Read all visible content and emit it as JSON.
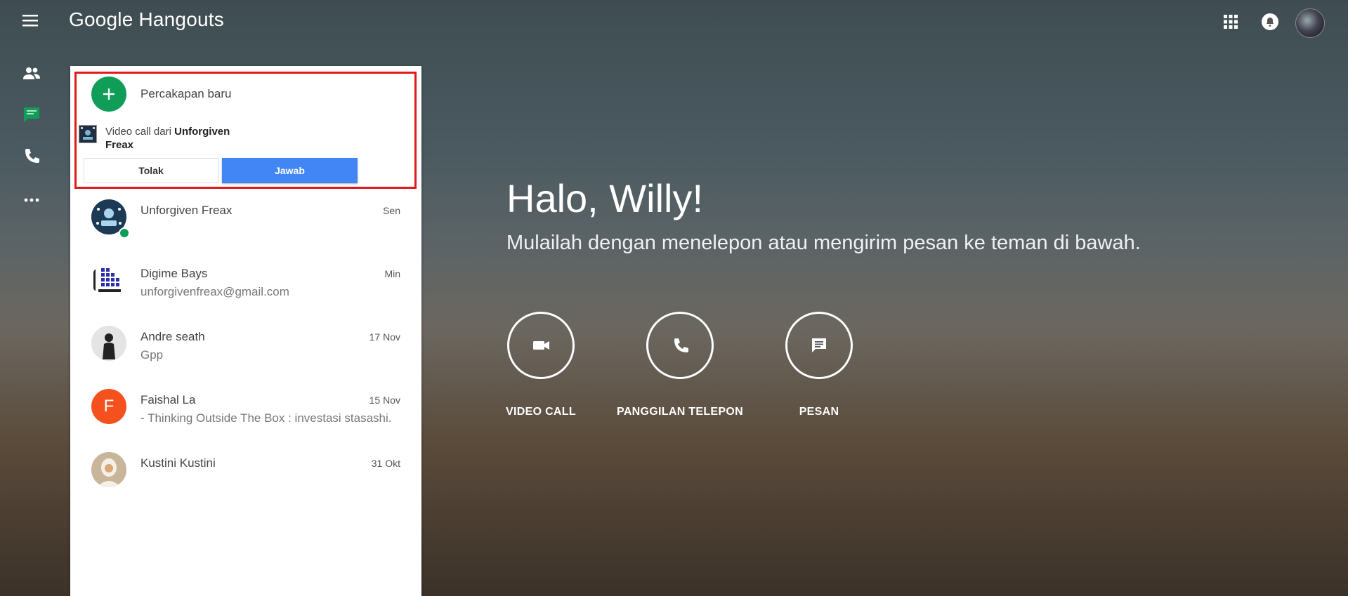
{
  "app": {
    "title": "Google Hangouts"
  },
  "new_conversation": {
    "label": "Percakapan baru"
  },
  "incoming_call": {
    "prefix": "Video call dari ",
    "caller_line1": "Unforgiven",
    "caller_line2": "Freax",
    "decline_label": "Tolak",
    "accept_label": "Jawab"
  },
  "conversations": [
    {
      "name": "Unforgiven Freax",
      "snippet": "",
      "date": "Sen",
      "online": true
    },
    {
      "name": "Digime Bays",
      "snippet": "unforgivenfreax@gmail.com",
      "date": "Min"
    },
    {
      "name": "Andre seath",
      "snippet": "Gpp",
      "date": "17 Nov"
    },
    {
      "name": "Faishal La",
      "snippet": "- Thinking Outside The Box : investasi stasashi.",
      "date": "15 Nov",
      "initial": "F"
    },
    {
      "name": "Kustini Kustini",
      "snippet": "",
      "date": "31 Okt"
    }
  ],
  "hero": {
    "greeting": "Halo, Willy!",
    "subtitle": "Mulailah dengan menelepon atau mengirim pesan ke teman di bawah."
  },
  "actions": [
    {
      "label": "VIDEO CALL",
      "icon": "videocam-icon"
    },
    {
      "label": "PANGGILAN TELEPON",
      "icon": "phone-icon"
    },
    {
      "label": "PESAN",
      "icon": "message-icon"
    }
  ],
  "colors": {
    "accent_green": "#0f9d58",
    "accept_blue": "#4285f4",
    "highlight_red": "#e01a1a",
    "avatar_orange": "#f4511e"
  }
}
